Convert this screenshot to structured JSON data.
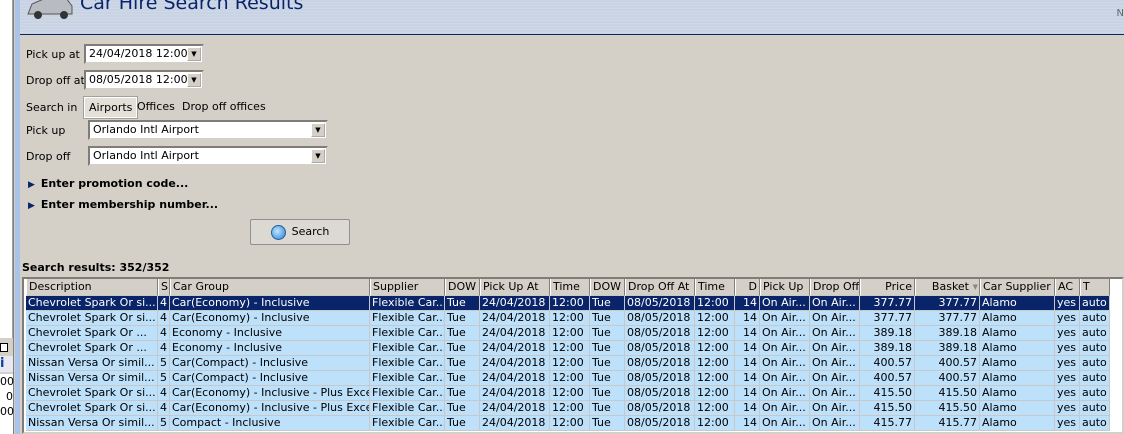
{
  "window": {
    "title": "Car Hire Search Results",
    "header_mark": "N"
  },
  "left_panel": {
    "info_icon": "i",
    "values": [
      "00",
      "0",
      "00"
    ]
  },
  "form": {
    "pickup_at_label": "Pick up at",
    "pickup_at_value": "24/04/2018 12:00",
    "dropoff_at_label": "Drop off at",
    "dropoff_at_value": "08/05/2018 12:00",
    "search_in_label": "Search in",
    "search_in_options": [
      "Airports",
      "Offices",
      "Drop off offices"
    ],
    "search_in_selected": "Airports",
    "pickup_label": "Pick up",
    "pickup_value": "Orlando Intl Airport",
    "dropoff_label": "Drop off",
    "dropoff_value": "Orlando Intl Airport",
    "promo_label": "Enter promotion code...",
    "membership_label": "Enter membership number...",
    "search_button": "Search"
  },
  "results": {
    "label": "Search results: 352/352",
    "sort_column": "Basket",
    "columns": [
      "Description",
      "S",
      "Car Group",
      "Supplier",
      "DOW",
      "Pick Up At",
      "Time",
      "DOW",
      "Drop Off At",
      "Time",
      "D",
      "Pick Up",
      "Drop Off",
      "Price",
      "Basket",
      "Car Supplier",
      "AC",
      "T"
    ],
    "rows": [
      [
        "Chevrolet Spark Or si...",
        "4",
        "Car(Economy) - Inclusive",
        "Flexible Car...",
        "Tue",
        "24/04/2018",
        "12:00",
        "Tue",
        "08/05/2018",
        "12:00",
        "14",
        "On Air...",
        "On Air...",
        "377.77",
        "377.77",
        "Alamo",
        "yes",
        "auto"
      ],
      [
        "Chevrolet Spark Or si...",
        "4",
        "Car(Economy) - Inclusive",
        "Flexible Car...",
        "Tue",
        "24/04/2018",
        "12:00",
        "Tue",
        "08/05/2018",
        "12:00",
        "14",
        "On Air...",
        "On Air...",
        "377.77",
        "377.77",
        "Alamo",
        "yes",
        "auto"
      ],
      [
        "Chevrolet  Spark Or ...",
        "4",
        "Economy - Inclusive",
        "Flexible Car...",
        "Tue",
        "24/04/2018",
        "12:00",
        "Tue",
        "08/05/2018",
        "12:00",
        "14",
        "On Air...",
        "On Air...",
        "389.18",
        "389.18",
        "Alamo",
        "yes",
        "auto"
      ],
      [
        "Chevrolet  Spark Or ...",
        "4",
        "Economy - Inclusive",
        "Flexible Car...",
        "Tue",
        "24/04/2018",
        "12:00",
        "Tue",
        "08/05/2018",
        "12:00",
        "14",
        "On Air...",
        "On Air...",
        "389.18",
        "389.18",
        "Alamo",
        "yes",
        "auto"
      ],
      [
        "Nissan Versa Or simil...",
        "5",
        "Car(Compact) - Inclusive",
        "Flexible Car...",
        "Tue",
        "24/04/2018",
        "12:00",
        "Tue",
        "08/05/2018",
        "12:00",
        "14",
        "On Air...",
        "On Air...",
        "400.57",
        "400.57",
        "Alamo",
        "yes",
        "auto"
      ],
      [
        "Nissan Versa Or simil...",
        "5",
        "Car(Compact) - Inclusive",
        "Flexible Car...",
        "Tue",
        "24/04/2018",
        "12:00",
        "Tue",
        "08/05/2018",
        "12:00",
        "14",
        "On Air...",
        "On Air...",
        "400.57",
        "400.57",
        "Alamo",
        "yes",
        "auto"
      ],
      [
        "Chevrolet Spark Or si...",
        "4",
        "Car(Economy) - Inclusive - Plus Exces...",
        "Flexible Car...",
        "Tue",
        "24/04/2018",
        "12:00",
        "Tue",
        "08/05/2018",
        "12:00",
        "14",
        "On Air...",
        "On Air...",
        "415.50",
        "415.50",
        "Alamo",
        "yes",
        "auto"
      ],
      [
        "Chevrolet Spark Or si...",
        "4",
        "Car(Economy) - Inclusive - Plus Exces...",
        "Flexible Car...",
        "Tue",
        "24/04/2018",
        "12:00",
        "Tue",
        "08/05/2018",
        "12:00",
        "14",
        "On Air...",
        "On Air...",
        "415.50",
        "415.50",
        "Alamo",
        "yes",
        "auto"
      ],
      [
        "Nissan Versa Or simil...",
        "5",
        "Compact - Inclusive",
        "Flexible Car...",
        "Tue",
        "24/04/2018",
        "12:00",
        "Tue",
        "08/05/2018",
        "12:00",
        "14",
        "On Air...",
        "On Air...",
        "415.77",
        "415.77",
        "Alamo",
        "yes",
        "auto"
      ]
    ],
    "selected_row": 0
  },
  "colors": {
    "selected": "#0a246a",
    "row": "#bde0fb",
    "title": "#0a246a"
  }
}
